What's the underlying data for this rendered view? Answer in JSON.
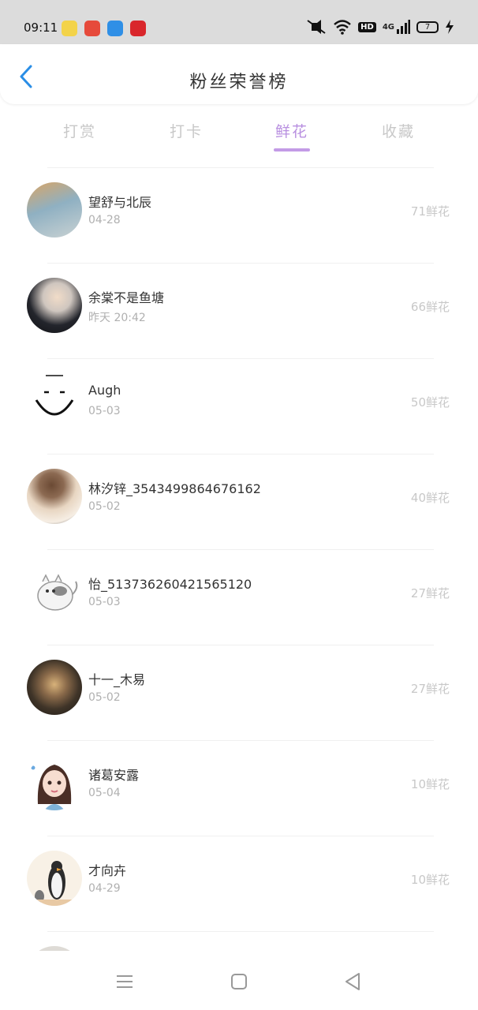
{
  "status_bar": {
    "time": "09:11",
    "apps": [
      {
        "icon": "app-icon-yellow",
        "color": "#f3d34a"
      },
      {
        "icon": "game-controller-icon",
        "color": "#e64a3b"
      },
      {
        "icon": "browser-icon",
        "color": "#2f8fe6"
      },
      {
        "icon": "news-app-icon",
        "color": "#d9262b"
      }
    ],
    "hd_label": "HD",
    "network_label": "4G",
    "battery_level": "7"
  },
  "header": {
    "title": "粉丝荣誉榜"
  },
  "tabs": [
    {
      "label": "打赏",
      "active": false
    },
    {
      "label": "打卡",
      "active": false
    },
    {
      "label": "鲜花",
      "active": true
    },
    {
      "label": "收藏",
      "active": false
    }
  ],
  "colors": {
    "accent": "#b88fe0",
    "back_arrow": "#2a8ee6"
  },
  "fans": [
    {
      "name": "望舒与北辰",
      "date": "04-28",
      "count": "71鲜花"
    },
    {
      "name": "余棠不是鱼塘",
      "date": "昨天 20:42",
      "count": "66鲜花"
    },
    {
      "name": "Augh",
      "date": "05-03",
      "count": "50鲜花"
    },
    {
      "name": "林汐锌_3543499864676162",
      "date": "05-02",
      "count": "40鲜花"
    },
    {
      "name": "怡_513736260421565120",
      "date": "05-03",
      "count": "27鲜花"
    },
    {
      "name": "十一_木易",
      "date": "05-02",
      "count": "27鲜花"
    },
    {
      "name": "诸葛安露",
      "date": "05-04",
      "count": "10鲜花"
    },
    {
      "name": "才向卉",
      "date": "04-29",
      "count": "10鲜花"
    }
  ]
}
